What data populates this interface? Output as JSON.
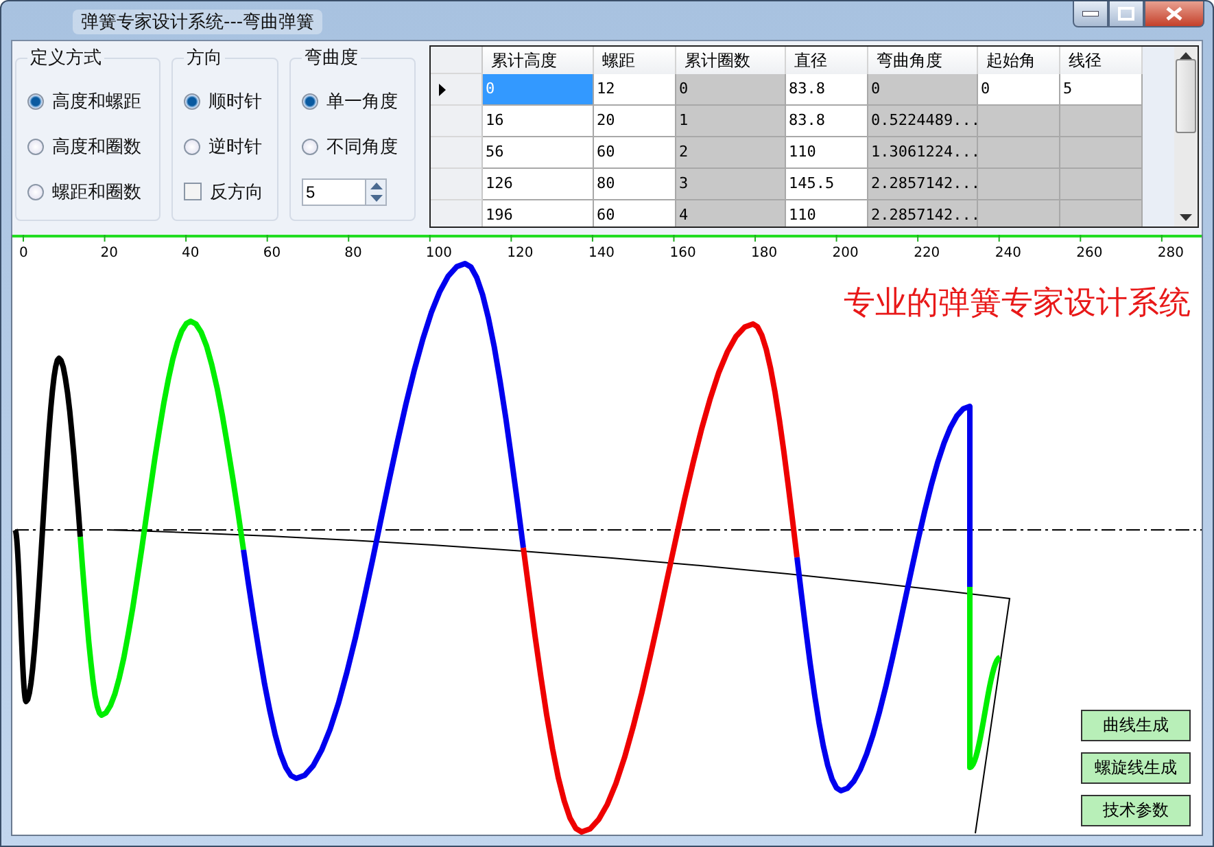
{
  "window": {
    "title": "弹簧专家设计系统---弯曲弹簧"
  },
  "groups": [
    {
      "title": "定义方式",
      "items": [
        {
          "kind": "radio",
          "label": "高度和螺距",
          "checked": true
        },
        {
          "kind": "radio",
          "label": "高度和圈数",
          "checked": false
        },
        {
          "kind": "radio",
          "label": "螺距和圈数",
          "checked": false
        }
      ]
    },
    {
      "title": "方向",
      "items": [
        {
          "kind": "radio",
          "label": "顺时针",
          "checked": true
        },
        {
          "kind": "radio",
          "label": "逆时针",
          "checked": false
        },
        {
          "kind": "checkbox",
          "label": "反方向",
          "checked": false
        }
      ]
    },
    {
      "title": "弯曲度",
      "items": [
        {
          "kind": "radio",
          "label": "单一角度",
          "checked": true
        },
        {
          "kind": "radio",
          "label": "不同角度",
          "checked": false
        },
        {
          "kind": "spinner",
          "value": "5"
        }
      ]
    }
  ],
  "table": {
    "columns": [
      "累计高度",
      "螺距",
      "累计圈数",
      "直径",
      "弯曲角度",
      "起始角",
      "线径"
    ],
    "rows": [
      {
        "current": true,
        "cells": [
          {
            "text": "0",
            "selected": true,
            "readonly": false
          },
          {
            "text": "12",
            "selected": false,
            "readonly": false
          },
          {
            "text": "0",
            "selected": false,
            "readonly": true
          },
          {
            "text": "83.8",
            "selected": false,
            "readonly": false
          },
          {
            "text": "0",
            "selected": false,
            "readonly": true
          },
          {
            "text": "0",
            "selected": false,
            "readonly": false
          },
          {
            "text": "5",
            "selected": false,
            "readonly": false
          }
        ]
      },
      {
        "current": false,
        "cells": [
          {
            "text": "16",
            "selected": false,
            "readonly": false
          },
          {
            "text": "20",
            "selected": false,
            "readonly": false
          },
          {
            "text": "1",
            "selected": false,
            "readonly": true
          },
          {
            "text": "83.8",
            "selected": false,
            "readonly": false
          },
          {
            "text": "0.5224489...",
            "selected": false,
            "readonly": true
          },
          {
            "selected": false,
            "readonly": true
          },
          {
            "selected": false,
            "readonly": true
          }
        ]
      },
      {
        "current": false,
        "cells": [
          {
            "text": "56",
            "selected": false,
            "readonly": false
          },
          {
            "text": "60",
            "selected": false,
            "readonly": false
          },
          {
            "text": "2",
            "selected": false,
            "readonly": true
          },
          {
            "text": "110",
            "selected": false,
            "readonly": false
          },
          {
            "text": "1.3061224...",
            "selected": false,
            "readonly": true
          },
          {
            "selected": false,
            "readonly": true
          },
          {
            "selected": false,
            "readonly": true
          }
        ]
      },
      {
        "current": false,
        "cells": [
          {
            "text": "126",
            "selected": false,
            "readonly": false
          },
          {
            "text": "80",
            "selected": false,
            "readonly": false
          },
          {
            "text": "3",
            "selected": false,
            "readonly": true
          },
          {
            "text": "145.5",
            "selected": false,
            "readonly": false
          },
          {
            "text": "2.2857142...",
            "selected": false,
            "readonly": true
          },
          {
            "selected": false,
            "readonly": true
          },
          {
            "selected": false,
            "readonly": true
          }
        ]
      },
      {
        "current": false,
        "cells": [
          {
            "text": "196",
            "selected": false,
            "readonly": false
          },
          {
            "text": "60",
            "selected": false,
            "readonly": false
          },
          {
            "text": "4",
            "selected": false,
            "readonly": true
          },
          {
            "text": "110",
            "selected": false,
            "readonly": false
          },
          {
            "text": "2.2857142...",
            "selected": false,
            "readonly": true
          },
          {
            "selected": false,
            "readonly": true
          },
          {
            "selected": false,
            "readonly": true
          }
        ]
      }
    ]
  },
  "canvas": {
    "heading": "专业的弹簧专家设计系统",
    "ruler_ticks": [
      "0",
      "20",
      "40",
      "60",
      "80",
      "100",
      "120",
      "140",
      "160",
      "180",
      "200",
      "220",
      "240",
      "260",
      "280"
    ]
  },
  "buttons": [
    "曲线生成",
    "螺旋线生成",
    "技术参数"
  ]
}
